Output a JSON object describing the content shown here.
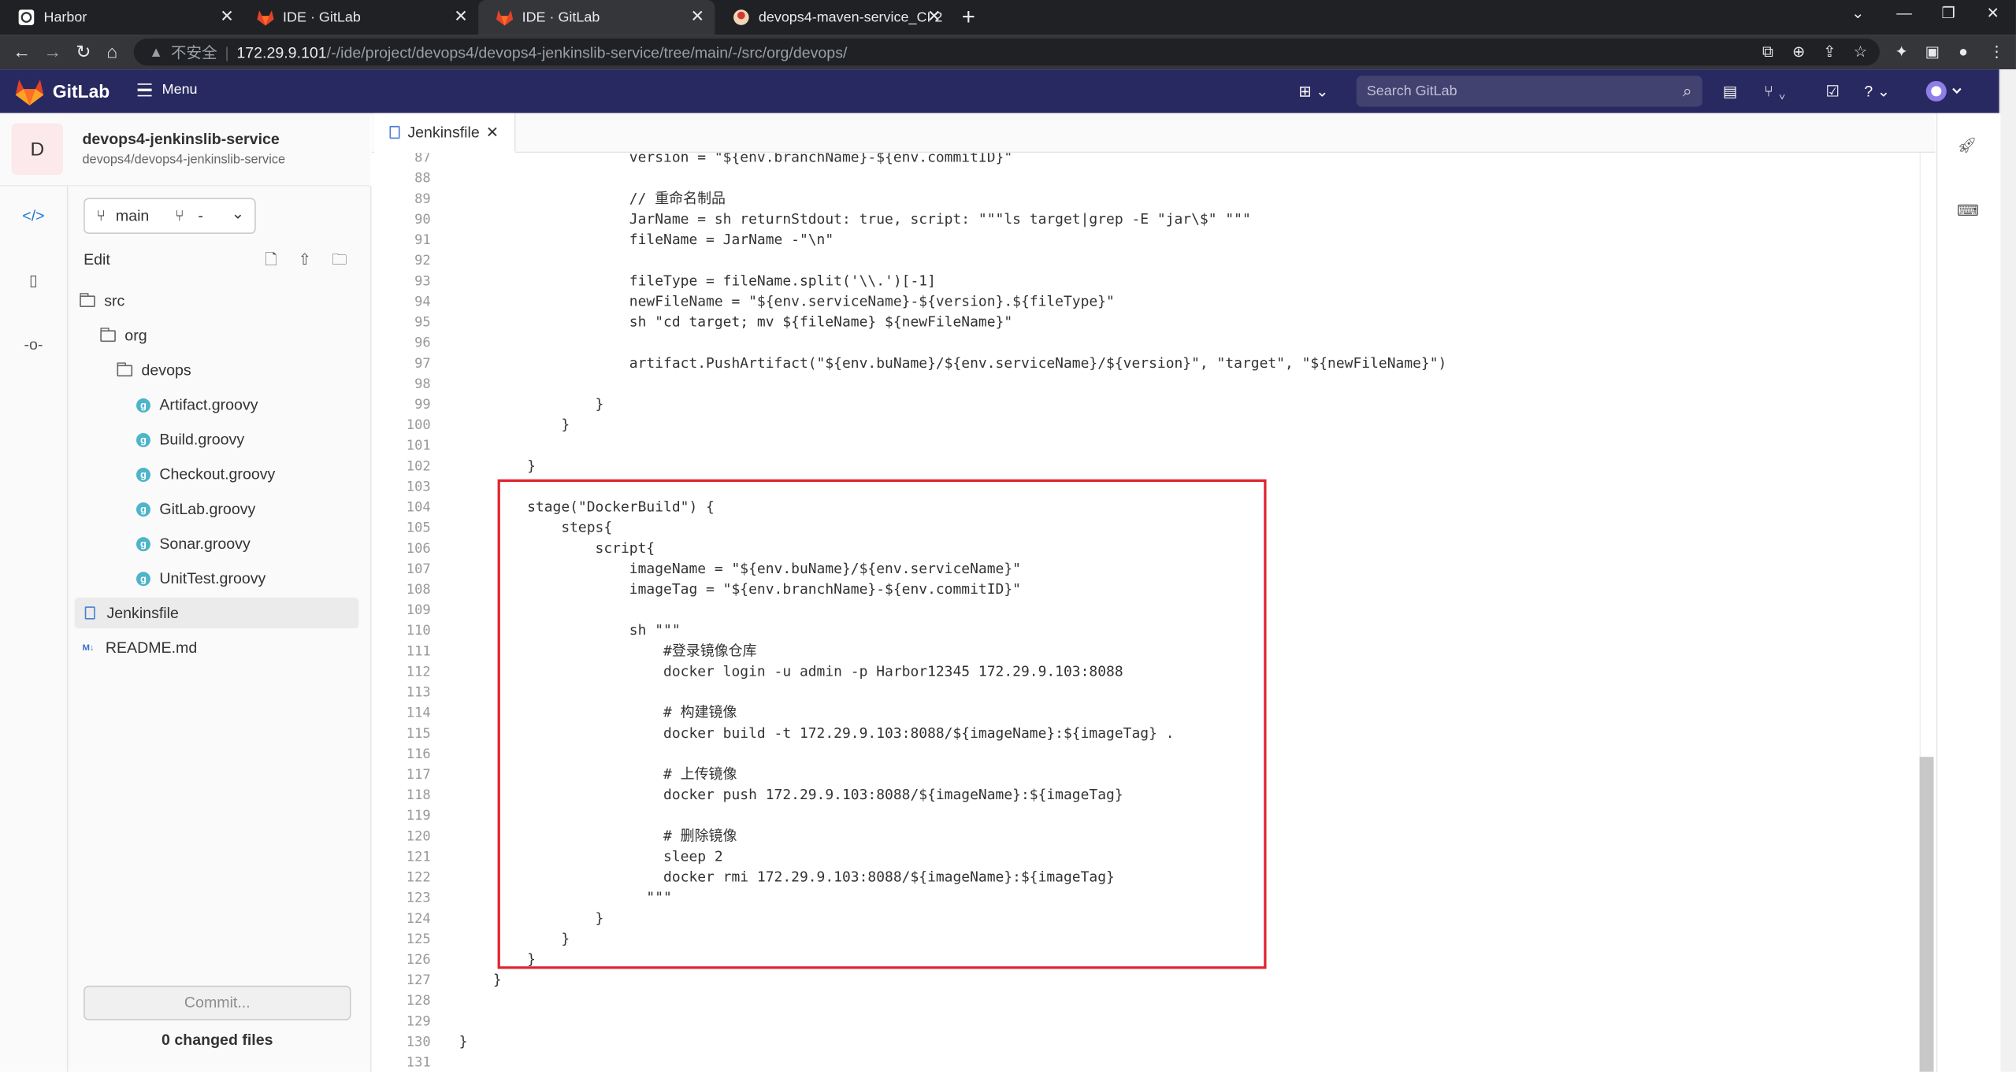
{
  "browser": {
    "tabs": [
      {
        "title": "Harbor",
        "active": false
      },
      {
        "title": "IDE · GitLab",
        "active": false
      },
      {
        "title": "IDE · GitLab",
        "active": true
      },
      {
        "title": "devops4-maven-service_CI 2",
        "active": false
      }
    ],
    "address": {
      "security": "不安全",
      "host": "172.29.9.101",
      "path": "/-/ide/project/devops4/devops4-jenkinslib-service/tree/main/-/src/org/devops/"
    }
  },
  "gitlab": {
    "brand": "GitLab",
    "menu_label": "Menu",
    "search_placeholder": "Search GitLab",
    "colors": {
      "header": "#292961",
      "redbox": "#e02530"
    }
  },
  "project": {
    "avatar_letter": "D",
    "name": "devops4-jenkinslib-service",
    "path": "devops4/devops4-jenkinslib-service"
  },
  "branch": {
    "name": "main",
    "mr": "-"
  },
  "filetree": {
    "edit_label": "Edit",
    "items": [
      {
        "label": "src",
        "type": "folder"
      },
      {
        "label": "org",
        "type": "folder"
      },
      {
        "label": "devops",
        "type": "folder"
      },
      {
        "label": "Artifact.groovy",
        "type": "groovy"
      },
      {
        "label": "Build.groovy",
        "type": "groovy"
      },
      {
        "label": "Checkout.groovy",
        "type": "groovy"
      },
      {
        "label": "GitLab.groovy",
        "type": "groovy"
      },
      {
        "label": "Sonar.groovy",
        "type": "groovy"
      },
      {
        "label": "UnitTest.groovy",
        "type": "groovy"
      },
      {
        "label": "Jenkinsfile",
        "type": "file"
      },
      {
        "label": "README.md",
        "type": "markdown"
      }
    ],
    "commit_label": "Commit...",
    "changed_files": "0 changed files"
  },
  "editor": {
    "tab_title": "Jenkinsfile",
    "lines": [
      {
        "n": "87",
        "code": "                    version = \"${env.branchName}-${env.commitID}\""
      },
      {
        "n": "88",
        "code": ""
      },
      {
        "n": "89",
        "code": "                    // 重命名制品"
      },
      {
        "n": "90",
        "code": "                    JarName = sh returnStdout: true, script: \"\"\"ls target|grep -E \"jar\\$\" \"\"\""
      },
      {
        "n": "91",
        "code": "                    fileName = JarName -\"\\n\""
      },
      {
        "n": "92",
        "code": ""
      },
      {
        "n": "93",
        "code": "                    fileType = fileName.split('\\\\.')[-1]"
      },
      {
        "n": "94",
        "code": "                    newFileName = \"${env.serviceName}-${version}.${fileType}\""
      },
      {
        "n": "95",
        "code": "                    sh \"cd target; mv ${fileName} ${newFileName}\""
      },
      {
        "n": "96",
        "code": ""
      },
      {
        "n": "97",
        "code": "                    artifact.PushArtifact(\"${env.buName}/${env.serviceName}/${version}\", \"target\", \"${newFileName}\")"
      },
      {
        "n": "98",
        "code": ""
      },
      {
        "n": "99",
        "code": "                }"
      },
      {
        "n": "100",
        "code": "            }"
      },
      {
        "n": "101",
        "code": ""
      },
      {
        "n": "102",
        "code": "        }"
      },
      {
        "n": "103",
        "code": ""
      },
      {
        "n": "104",
        "code": "        stage(\"DockerBuild\") {"
      },
      {
        "n": "105",
        "code": "            steps{"
      },
      {
        "n": "106",
        "code": "                script{"
      },
      {
        "n": "107",
        "code": "                    imageName = \"${env.buName}/${env.serviceName}\""
      },
      {
        "n": "108",
        "code": "                    imageTag = \"${env.branchName}-${env.commitID}\""
      },
      {
        "n": "109",
        "code": ""
      },
      {
        "n": "110",
        "code": "                    sh \"\"\""
      },
      {
        "n": "111",
        "code": "                        #登录镜像仓库"
      },
      {
        "n": "112",
        "code": "                        docker login -u admin -p Harbor12345 172.29.9.103:8088"
      },
      {
        "n": "113",
        "code": ""
      },
      {
        "n": "114",
        "code": "                        # 构建镜像"
      },
      {
        "n": "115",
        "code": "                        docker build -t 172.29.9.103:8088/${imageName}:${imageTag} ."
      },
      {
        "n": "116",
        "code": ""
      },
      {
        "n": "117",
        "code": "                        # 上传镜像"
      },
      {
        "n": "118",
        "code": "                        docker push 172.29.9.103:8088/${imageName}:${imageTag}"
      },
      {
        "n": "119",
        "code": ""
      },
      {
        "n": "120",
        "code": "                        # 删除镜像"
      },
      {
        "n": "121",
        "code": "                        sleep 2"
      },
      {
        "n": "122",
        "code": "                        docker rmi 172.29.9.103:8088/${imageName}:${imageTag}"
      },
      {
        "n": "123",
        "code": "                      \"\"\""
      },
      {
        "n": "124",
        "code": "                }"
      },
      {
        "n": "125",
        "code": "            }"
      },
      {
        "n": "126",
        "code": "        }"
      },
      {
        "n": "127",
        "code": "    }"
      },
      {
        "n": "128",
        "code": ""
      },
      {
        "n": "129",
        "code": ""
      },
      {
        "n": "130",
        "code": "}"
      },
      {
        "n": "131",
        "code": ""
      }
    ]
  }
}
